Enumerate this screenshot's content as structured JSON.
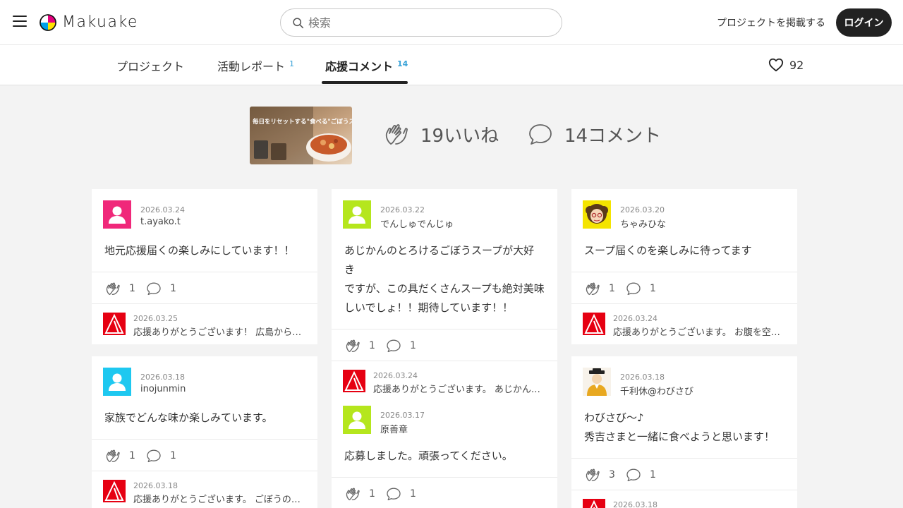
{
  "header": {
    "logo_text": "Makuake",
    "search_placeholder": "検索",
    "post_project_label": "プロジェクトを掲載する",
    "login_label": "ログイン"
  },
  "tabs": [
    {
      "label": "プロジェクト",
      "count": ""
    },
    {
      "label": "活動レポート",
      "count": "1"
    },
    {
      "label": "応援コメント",
      "count": "14"
    }
  ],
  "favorite_count": "92",
  "summary": {
    "likes": "19いいね",
    "comments": "14コメント",
    "thumbnail_caption": "毎日をリセットする\"食べる\"ごぼうスープ、誕生"
  },
  "cards": [
    {
      "date": "2026.03.24",
      "user": "t.ayako.t",
      "body": "地元応援届くの楽しみにしています！！",
      "likes": "1",
      "comments": "1",
      "reply_date": "2026.03.25",
      "reply_text": "応援ありがとうございます！ 広島から…"
    },
    {
      "date": "2026.03.18",
      "user": "inojunmin",
      "body": "家族でどんな味か楽しみています。",
      "likes": "1",
      "comments": "1",
      "reply_date": "2026.03.18",
      "reply_text": "応援ありがとうございます。 ごぼうの…"
    },
    {
      "date": "2026.03.22",
      "user": "でんしゅでんじゅ",
      "body": "あじかんのとろけるごぼうスープが大好き\nですが、この具だくさんスープも絶対美味\nしいでしょ！！期待しています！！",
      "likes": "1",
      "comments": "1",
      "reply_date": "2026.03.24",
      "reply_text": "応援ありがとうございます。 あじかん…"
    },
    {
      "date": "2026.03.17",
      "user": "原善章",
      "body": "応募しました。頑張ってください。",
      "likes": "1",
      "comments": "1"
    },
    {
      "date": "2026.03.20",
      "user": "ちゃみひな",
      "body": "スープ届くのを楽しみに待ってます",
      "likes": "1",
      "comments": "1",
      "reply_date": "2026.03.24",
      "reply_text": "応援ありがとうございます。 お腹を空…"
    },
    {
      "date": "2026.03.18",
      "user": "千利休@わびさび",
      "body": "わびさび〜♪\n秀吉さまと一緒に食べようと思います！",
      "likes": "3",
      "comments": "1",
      "reply_date": "2026.03.18"
    }
  ],
  "colors": {
    "accent_blue": "#3aa3d8",
    "pink_avatar": "#f0287a",
    "lime_avatar": "#b5e61d",
    "cyan_avatar": "#1ec8f0",
    "reply_red": "#e60012"
  }
}
